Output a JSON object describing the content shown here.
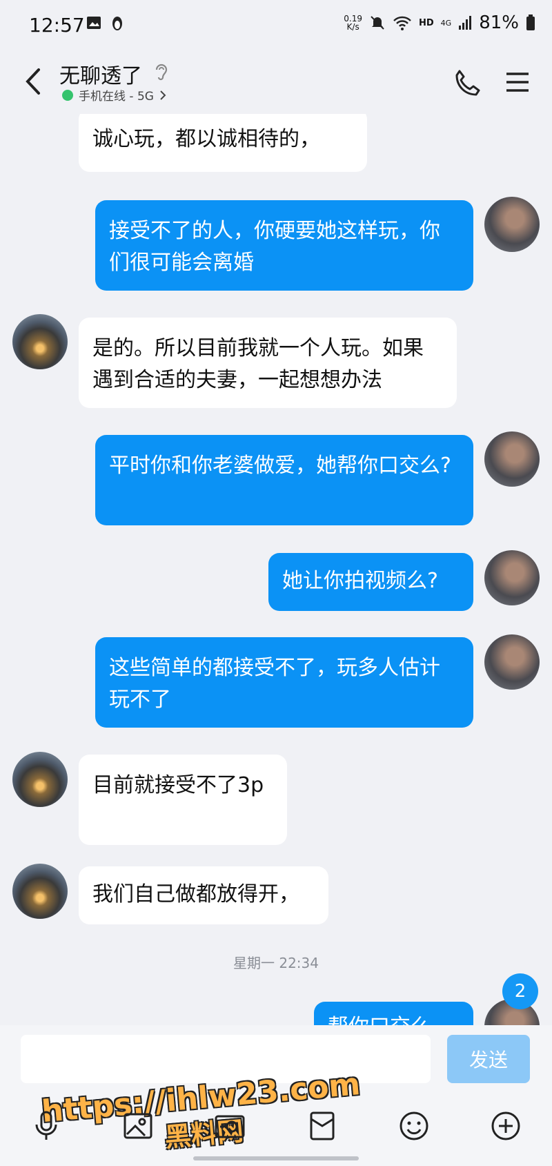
{
  "status_bar": {
    "time": "12:57",
    "net_speed_value": "0.19",
    "net_speed_unit": "K/s",
    "hd_label": "HD",
    "cell_label": "4G",
    "battery": "81%"
  },
  "header": {
    "title": "无聊透了",
    "presence": "手机在线 - 5G",
    "presence_color": "#35c36d"
  },
  "messages": [
    {
      "side": "in",
      "text": "诚心玩，都以诚相待的，"
    },
    {
      "side": "out",
      "text": "接受不了的人，你硬要她这样玩，你们很可能会离婚"
    },
    {
      "side": "in",
      "text": "是的。所以目前我就一个人玩。如果遇到合适的夫妻，一起想想办法"
    },
    {
      "side": "out",
      "text": "平时你和你老婆做爱，她帮你口交么?"
    },
    {
      "side": "out",
      "text": "她让你拍视频么?"
    },
    {
      "side": "out",
      "text": "这些简单的都接受不了，玩多人估计玩不了"
    },
    {
      "side": "in",
      "text": "目前就接受不了3p"
    },
    {
      "side": "in",
      "text": "我们自己做都放得开，"
    },
    {
      "side": "out",
      "text": "帮你口交么"
    }
  ],
  "time_divider": "星期一 22:34",
  "unread_count": "2",
  "composer": {
    "input_value": "",
    "send_label": "发送"
  },
  "watermark": {
    "url": "https://ihlw23.com",
    "name": "黑料网"
  },
  "toolbar": {
    "icons": [
      "microphone-icon",
      "image-icon",
      "camera-icon",
      "red-packet-icon",
      "emoji-icon",
      "plus-icon"
    ]
  },
  "colors": {
    "outgoing_bubble": "#0b92f5",
    "incoming_bubble": "#ffffff",
    "background": "#f0f1f5"
  }
}
